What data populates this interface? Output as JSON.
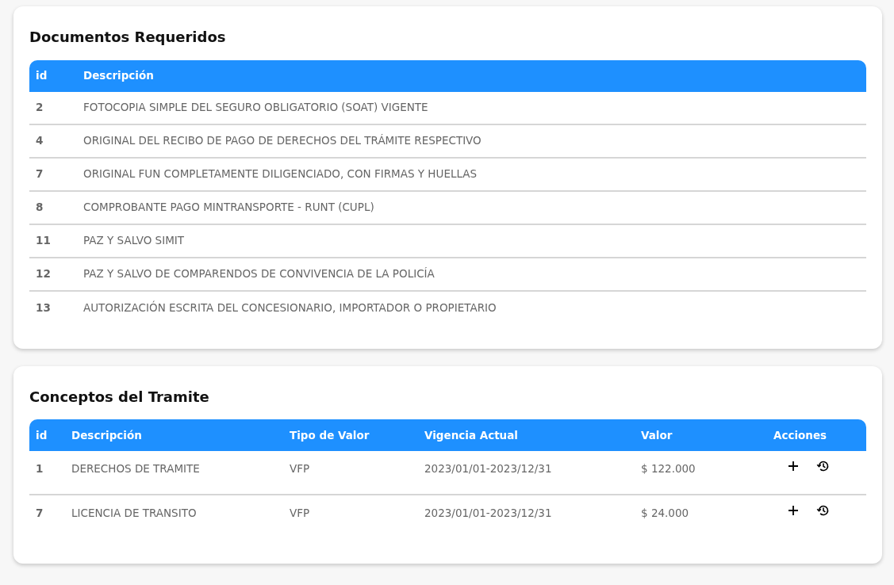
{
  "documents": {
    "title": "Documentos Requeridos",
    "columns": [
      "id",
      "Descripción"
    ],
    "rows": [
      {
        "id": "2",
        "description": "FOTOCOPIA SIMPLE DEL SEGURO OBLIGATORIO (SOAT) VIGENTE"
      },
      {
        "id": "4",
        "description": "ORIGINAL DEL RECIBO DE PAGO DE DERECHOS DEL TRÁMITE RESPECTIVO"
      },
      {
        "id": "7",
        "description": "ORIGINAL FUN COMPLETAMENTE DILIGENCIADO, CON FIRMAS Y HUELLAS"
      },
      {
        "id": "8",
        "description": "COMPROBANTE PAGO MINTRANSPORTE - RUNT (CUPL)"
      },
      {
        "id": "11",
        "description": "PAZ Y SALVO SIMIT"
      },
      {
        "id": "12",
        "description": "PAZ Y SALVO DE COMPARENDOS DE CONVIVENCIA DE LA POLICÍA"
      },
      {
        "id": "13",
        "description": "AUTORIZACIÓN ESCRITA DEL CONCESIONARIO, IMPORTADOR O PROPIETARIO"
      }
    ]
  },
  "concepts": {
    "title": "Conceptos del Tramite",
    "columns": [
      "id",
      "Descripción",
      "Tipo de Valor",
      "Vigencia Actual",
      "Valor",
      "Acciones"
    ],
    "rows": [
      {
        "id": "1",
        "description": "DERECHOS DE TRAMITE",
        "value_type": "VFP",
        "validity": "2023/01/01-2023/12/31",
        "value": "$ 122.000"
      },
      {
        "id": "7",
        "description": "LICENCIA DE TRANSITO",
        "value_type": "VFP",
        "validity": "2023/01/01-2023/12/31",
        "value": "$ 24.000"
      }
    ]
  }
}
